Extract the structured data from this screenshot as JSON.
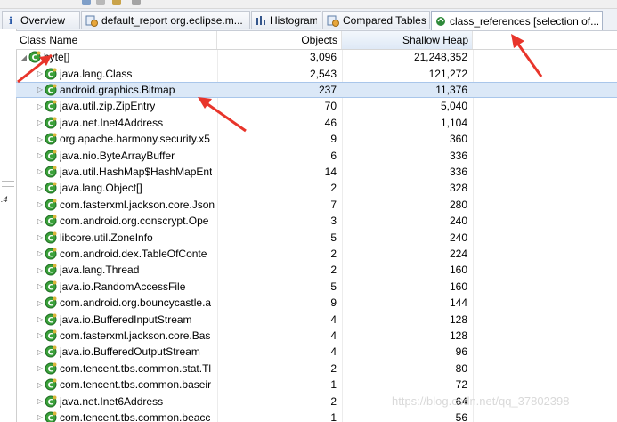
{
  "tabs": [
    {
      "label": "Overview",
      "icon": "info-icon",
      "active": false
    },
    {
      "label": "default_report  org.eclipse.m...",
      "icon": "report-icon",
      "active": false
    },
    {
      "label": "Histogram",
      "icon": "histogram-icon",
      "active": false
    },
    {
      "label": "Compared Tables",
      "icon": "compare-icon",
      "active": false
    },
    {
      "label": "class_references [selection of...",
      "icon": "references-icon",
      "active": true
    }
  ],
  "columns": {
    "name": "Class Name",
    "objects": "Objects",
    "heap": "Shallow Heap"
  },
  "root": {
    "name": "byte[]",
    "objects": "3,096",
    "heap": "21,248,352"
  },
  "rows": [
    {
      "name": "java.lang.Class",
      "objects": "2,543",
      "heap": "121,272"
    },
    {
      "name": "android.graphics.Bitmap",
      "objects": "237",
      "heap": "11,376"
    },
    {
      "name": "java.util.zip.ZipEntry",
      "objects": "70",
      "heap": "5,040"
    },
    {
      "name": "java.net.Inet4Address",
      "objects": "46",
      "heap": "1,104"
    },
    {
      "name": "org.apache.harmony.security.x5",
      "objects": "9",
      "heap": "360"
    },
    {
      "name": "java.nio.ByteArrayBuffer",
      "objects": "6",
      "heap": "336"
    },
    {
      "name": "java.util.HashMap$HashMapEnt",
      "objects": "14",
      "heap": "336"
    },
    {
      "name": "java.lang.Object[]",
      "objects": "2",
      "heap": "328"
    },
    {
      "name": "com.fasterxml.jackson.core.Json",
      "objects": "7",
      "heap": "280"
    },
    {
      "name": "com.android.org.conscrypt.Ope",
      "objects": "3",
      "heap": "240"
    },
    {
      "name": "libcore.util.ZoneInfo",
      "objects": "5",
      "heap": "240"
    },
    {
      "name": "com.android.dex.TableOfConte",
      "objects": "2",
      "heap": "224"
    },
    {
      "name": "java.lang.Thread",
      "objects": "2",
      "heap": "160"
    },
    {
      "name": "java.io.RandomAccessFile",
      "objects": "5",
      "heap": "160"
    },
    {
      "name": "com.android.org.bouncycastle.a",
      "objects": "9",
      "heap": "144"
    },
    {
      "name": "java.io.BufferedInputStream",
      "objects": "4",
      "heap": "128"
    },
    {
      "name": "com.fasterxml.jackson.core.Bas",
      "objects": "4",
      "heap": "128"
    },
    {
      "name": "java.io.BufferedOutputStream",
      "objects": "4",
      "heap": "96"
    },
    {
      "name": "com.tencent.tbs.common.stat.Tl",
      "objects": "2",
      "heap": "80"
    },
    {
      "name": "com.tencent.tbs.common.baseir",
      "objects": "1",
      "heap": "72"
    },
    {
      "name": "java.net.Inet6Address",
      "objects": "2",
      "heap": "64"
    },
    {
      "name": "com.tencent.tbs.common.beacc",
      "objects": "1",
      "heap": "56"
    }
  ],
  "selected_row_index": 1,
  "left_panel_text": ".4",
  "watermark": "https://blog.csdn.net/qq_37802398",
  "colors": {
    "accent_arrow": "#e8352b",
    "selection": "#dbe8f7",
    "class_icon": "#3aa03a"
  }
}
